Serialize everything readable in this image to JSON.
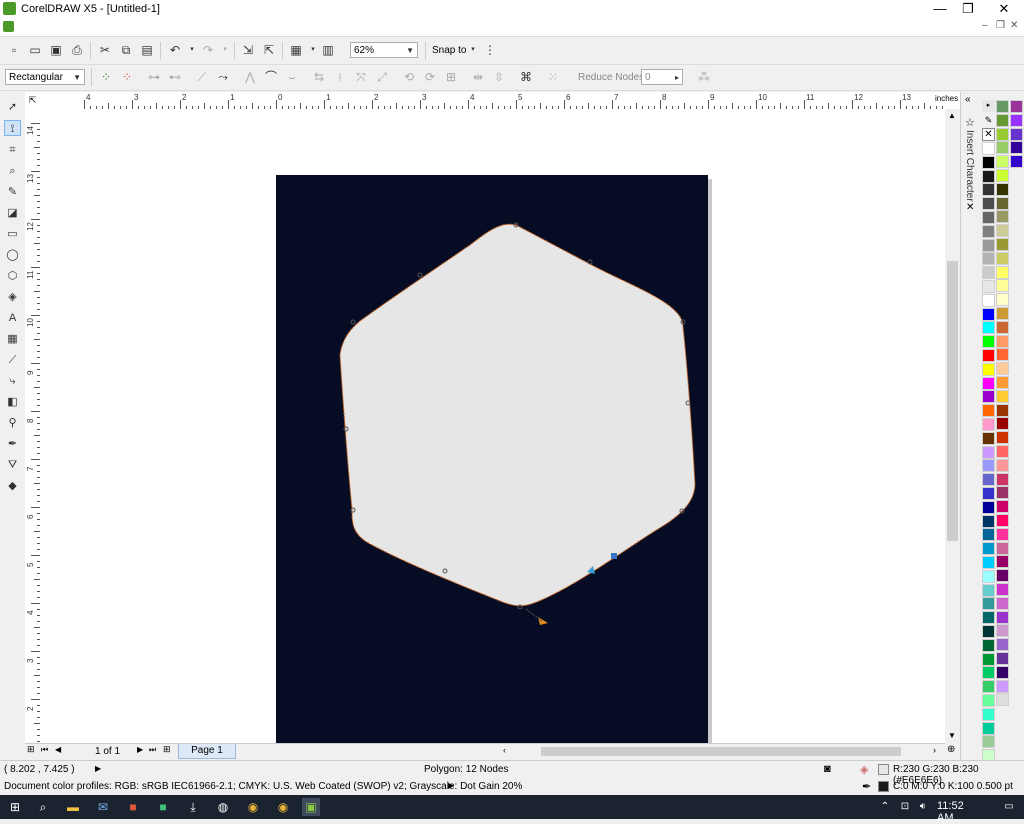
{
  "window": {
    "title": "CorelDRAW X5 - [Untitled-1]",
    "minimize_icon": "minimize-icon",
    "maximize_icon": "restore-icon",
    "close_icon": "close-icon"
  },
  "toolbar": {
    "zoom_value": "62%",
    "snap_label": "Snap to",
    "icons": [
      "new-icon",
      "open-icon",
      "save-icon",
      "print-icon",
      "cut-icon",
      "copy-icon",
      "paste-icon",
      "undo-icon",
      "redo-icon",
      "import-icon",
      "export-icon",
      "app-launcher-icon",
      "welcome-screen-icon",
      "snap-options-icon"
    ]
  },
  "property_bar": {
    "mode_value": "Rectangular",
    "reduce_nodes_label": "Reduce Nodes",
    "reduce_nodes_value": "0"
  },
  "ruler": {
    "unit": "inches",
    "h_labels": [
      "4",
      "3",
      "2",
      "1",
      "0",
      "1",
      "2",
      "3",
      "4",
      "5",
      "6",
      "7",
      "8",
      "9",
      "10",
      "11",
      "12",
      "13"
    ],
    "v_labels": [
      "14",
      "13",
      "12",
      "11",
      "10",
      "9",
      "8",
      "7",
      "6",
      "5",
      "4",
      "3",
      "2"
    ]
  },
  "docker": {
    "label": "Insert Character"
  },
  "page_nav": {
    "counter": "1 of 1",
    "tab": "Page 1"
  },
  "status": {
    "coords": "( 8.202 , 7.425 )",
    "object_info": "Polygon: 12 Nodes",
    "fill_info": "R:230 G:230 B:230 (#E6E6E6)",
    "outline_info": "C:0 M:0 Y:0 K:100  0.500 pt",
    "color_profiles": "Document color profiles: RGB: sRGB IEC61966-2.1; CMYK: U.S. Web Coated (SWOP) v2; Grayscale: Dot Gain 20%"
  },
  "shape": {
    "fill": "#E6E6E6",
    "page_color": "#050C24"
  },
  "palette_colors": [
    "#FFFFFF",
    "#000000",
    "#1A1A1A",
    "#333333",
    "#4D4D4D",
    "#666666",
    "#808080",
    "#999999",
    "#B3B3B3",
    "#CCCCCC",
    "#E6E6E6",
    "#FFFFFF",
    "#0000FF",
    "#00FFFF",
    "#00FF00",
    "#FF0000",
    "#FFFF00",
    "#FF00FF",
    "#9900CC",
    "#FF6600",
    "#FF99CC",
    "#663300",
    "#CC99FF",
    "#9999FF",
    "#6666CC",
    "#3333CC",
    "#000099",
    "#003366",
    "#006699",
    "#0099CC",
    "#00CCFF",
    "#99FFFF",
    "#66CCCC",
    "#339999",
    "#006666",
    "#003333",
    "#006633",
    "#009933",
    "#00CC66",
    "#33CC66",
    "#66FF99",
    "#33FFCC",
    "#00CC99",
    "#99CC99",
    "#CCFFCC",
    "#66FF66"
  ],
  "palette_colors2": [
    "#669966",
    "#669933",
    "#99CC33",
    "#99CC66",
    "#CCFF66",
    "#CCFF33",
    "#333300",
    "#666633",
    "#999966",
    "#CCCC99",
    "#999933",
    "#CCCC66",
    "#FFFF66",
    "#FFFF99",
    "#FFFFCC",
    "#CC9933",
    "#CC6633",
    "#FF9966",
    "#FF6633",
    "#FFCC99",
    "#FF9933",
    "#FFCC33",
    "#993300",
    "#990000",
    "#CC3300",
    "#FF6666",
    "#FF9999",
    "#CC3366",
    "#993366",
    "#CC0066",
    "#FF0066",
    "#FF3399",
    "#CC6699",
    "#990066",
    "#660066",
    "#CC33CC",
    "#CC66CC",
    "#9933CC",
    "#CC99CC",
    "#9966CC",
    "#663399",
    "#330066",
    "#CC99FF",
    "#DDDDDD"
  ],
  "palette_colors3": [
    "#993399",
    "#9933FF",
    "#6633CC",
    "#330099",
    "#3300CC"
  ]
}
